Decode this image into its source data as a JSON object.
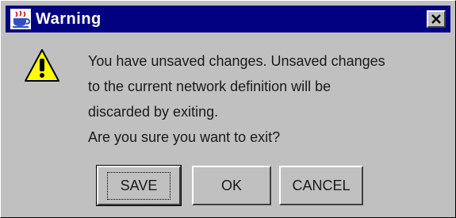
{
  "window": {
    "title": "Warning",
    "close_glyph": "×",
    "title_bar_color": "#000080",
    "background_color": "#c0c0c0"
  },
  "icons": {
    "app": "java-cup-icon",
    "warning": "warning-icon",
    "warning_glyph": "!",
    "close": "close-icon"
  },
  "message": {
    "lines": [
      "You have unsaved changes.  Unsaved changes",
      "to the current network definition will be",
      "discarded by exiting.",
      "Are you sure you want to exit?"
    ]
  },
  "buttons": {
    "save": "SAVE",
    "ok": "OK",
    "cancel": "CANCEL"
  }
}
